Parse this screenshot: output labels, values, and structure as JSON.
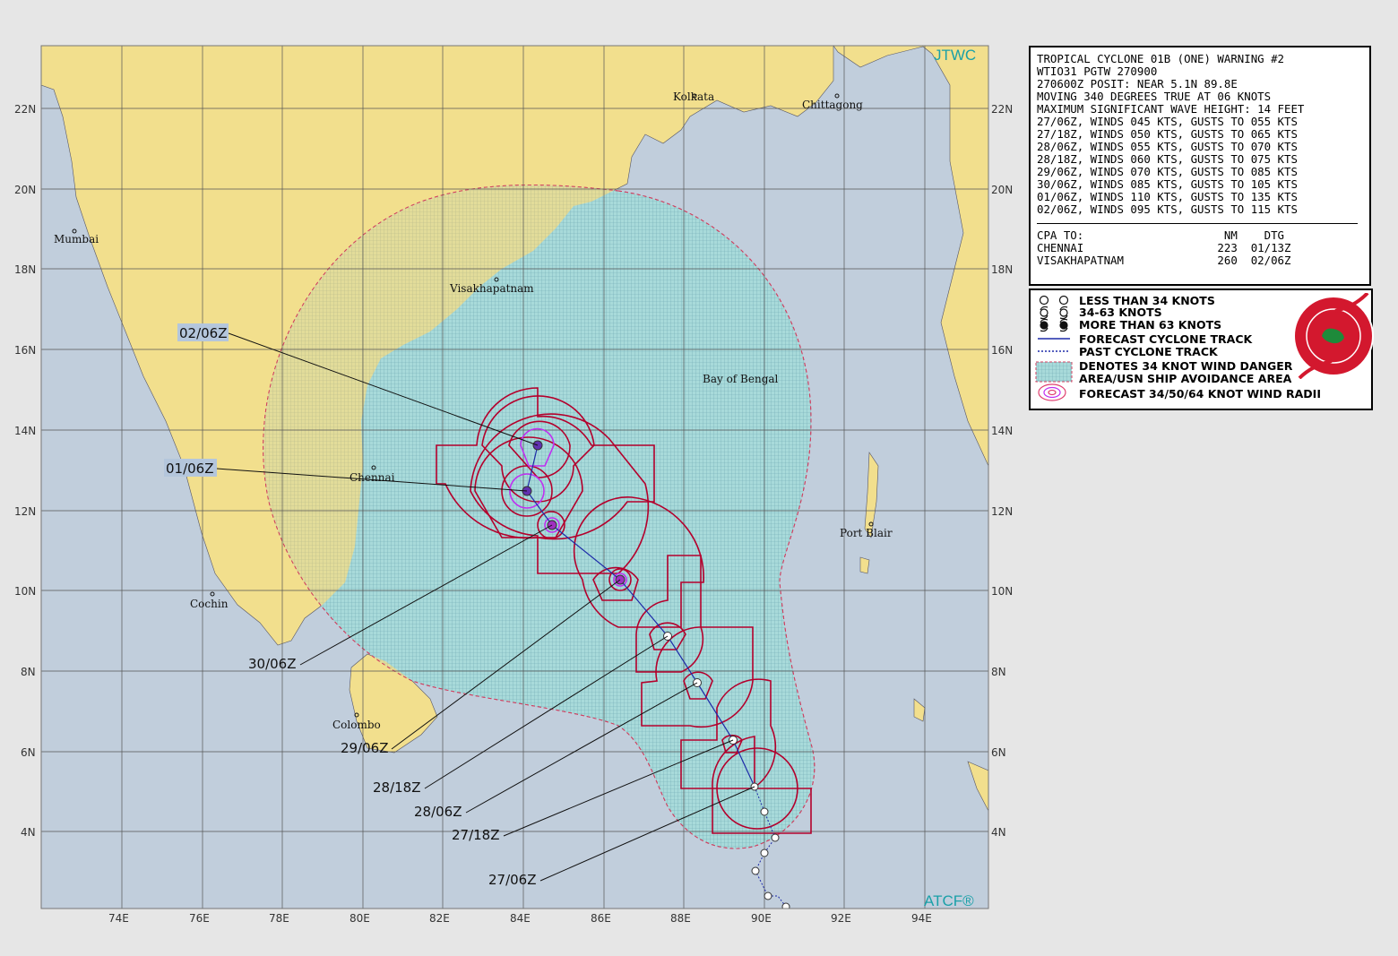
{
  "map": {
    "agency": "JTWC",
    "software": "ATCF®",
    "lat_labels": [
      "22N",
      "20N",
      "18N",
      "16N",
      "14N",
      "12N",
      "10N",
      "8N",
      "6N",
      "4N"
    ],
    "lon_labels": [
      "74E",
      "76E",
      "78E",
      "80E",
      "82E",
      "84E",
      "86E",
      "88E",
      "90E",
      "92E",
      "94E"
    ],
    "places": [
      "Kolkata",
      "Chittagong",
      "Mumbai",
      "Visakhapatnam",
      "Bay of Bengal",
      "Chennai",
      "Port Blair",
      "Cochin",
      "Colombo"
    ],
    "forecast_labels": [
      "02/06Z",
      "01/06Z",
      "30/06Z",
      "29/06Z",
      "28/18Z",
      "28/06Z",
      "27/18Z",
      "27/06Z"
    ],
    "colors": {
      "land": "#f2df8d",
      "sea": "#c1cedc",
      "radii": "#b4002c",
      "danger": "#9ad5d5",
      "track": "#1d2aa8"
    }
  },
  "warning": {
    "lines": [
      "TROPICAL CYCLONE 01B (ONE) WARNING #2",
      "WTIO31 PGTW 270900",
      "270600Z POSIT: NEAR 5.1N 89.8E",
      "MOVING 340 DEGREES TRUE AT 06 KNOTS",
      "MAXIMUM SIGNIFICANT WAVE HEIGHT: 14 FEET",
      "27/06Z, WINDS 045 KTS, GUSTS TO 055 KTS",
      "27/18Z, WINDS 050 KTS, GUSTS TO 065 KTS",
      "28/06Z, WINDS 055 KTS, GUSTS TO 070 KTS",
      "28/18Z, WINDS 060 KTS, GUSTS TO 075 KTS",
      "29/06Z, WINDS 070 KTS, GUSTS TO 085 KTS",
      "30/06Z, WINDS 085 KTS, GUSTS TO 105 KTS",
      "01/06Z, WINDS 110 KTS, GUSTS TO 135 KTS",
      "02/06Z, WINDS 095 KTS, GUSTS TO 115 KTS"
    ],
    "cpa_lines": [
      "CPA TO:                     NM    DTG",
      "CHENNAI                    223  01/13Z",
      "VISAKHAPATNAM              260  02/06Z"
    ]
  },
  "legend": {
    "items": [
      "LESS THAN 34 KNOTS",
      "34-63 KNOTS",
      "MORE THAN 63 KNOTS",
      "FORECAST CYCLONE TRACK",
      "PAST CYCLONE TRACK",
      "DENOTES 34 KNOT WIND DANGER",
      "AREA/USN SHIP AVOIDANCE AREA",
      "FORECAST 34/50/64 KNOT WIND RADII"
    ],
    "seal": {
      "top": "JOINT TYPHOON WARNING CENTER",
      "bottom": "PEARL HARBOR",
      "state": "HAWAII"
    }
  }
}
